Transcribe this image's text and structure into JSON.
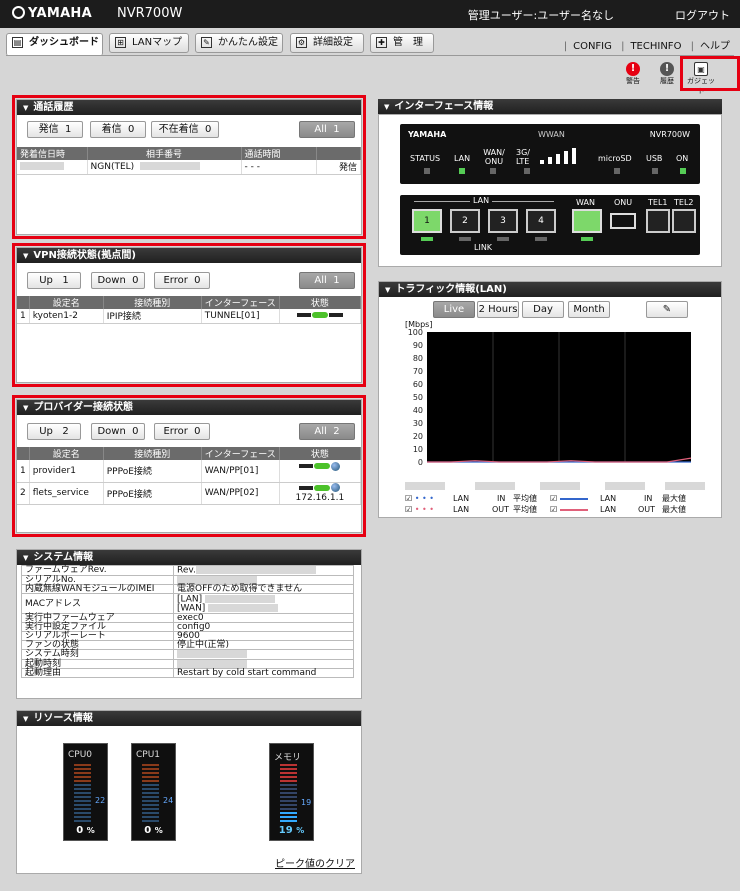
{
  "header": {
    "logo": "YAMAHA",
    "model": "NVR700W",
    "admin_user": "管理ユーザー:ユーザー名なし",
    "logout": "ログアウト"
  },
  "tabs": [
    {
      "label": "ダッシュボード",
      "active": true
    },
    {
      "label": "LANマップ"
    },
    {
      "label": "かんたん設定"
    },
    {
      "label": "詳細設定"
    },
    {
      "label": "管　理"
    }
  ],
  "sublinks": [
    "CONFIG",
    "TECHINFO",
    "ヘルプ"
  ],
  "status_icons": [
    {
      "label": "警告",
      "color": "#e60012"
    },
    {
      "label": "履歴",
      "color": "#555555"
    },
    {
      "label": "ガジェット",
      "color": "#555555"
    }
  ],
  "call_history": {
    "title": "通話履歴",
    "outgoing": "発信",
    "outgoing_count": "1",
    "incoming": "着信",
    "incoming_count": "0",
    "missed": "不在着信",
    "missed_count": "0",
    "all": "All",
    "all_count": "1",
    "columns": [
      "発着信日時",
      "相手番号",
      "通話時間",
      ""
    ],
    "rows": [
      {
        "line": "NGN(TEL)",
        "duration": "- - -",
        "type": "発信"
      }
    ]
  },
  "vpn": {
    "title": "VPN接続状態(拠点間)",
    "up": "Up",
    "up_count": "1",
    "down": "Down",
    "down_count": "0",
    "error": "Error",
    "error_count": "0",
    "all": "All",
    "all_count": "1",
    "columns": [
      "設定名",
      "接続種別",
      "インターフェース",
      "状態"
    ],
    "rows": [
      {
        "no": "1",
        "name": "kyoten1-2",
        "type": "IPIP接続",
        "iface": "TUNNEL[01]"
      }
    ]
  },
  "provider": {
    "title": "プロバイダー接続状態",
    "up": "Up",
    "up_count": "2",
    "down": "Down",
    "down_count": "0",
    "error": "Error",
    "error_count": "0",
    "all": "All",
    "all_count": "2",
    "columns": [
      "設定名",
      "接続種別",
      "インターフェース",
      "状態"
    ],
    "rows": [
      {
        "no": "1",
        "name": "provider1",
        "type": "PPPoE接続",
        "iface": "WAN/PP[01]",
        "ip": ""
      },
      {
        "no": "2",
        "name": "flets_service",
        "type": "PPPoE接続",
        "iface": "WAN/PP[02]",
        "ip": "172.16.1.1"
      }
    ]
  },
  "sysinfo": {
    "title": "システム情報",
    "rows": [
      {
        "k": "ファームウェアRev.",
        "v": "Rev.",
        "blur": true
      },
      {
        "k": "シリアルNo.",
        "v": "",
        "blur": true
      },
      {
        "k": "内蔵無線WANモジュールのIMEI",
        "v": "電源OFFのため取得できません"
      },
      {
        "k": "MACアドレス",
        "v": "[LAN]",
        "v2": "[WAN]",
        "blur": true
      },
      {
        "k": "実行中ファームウェア",
        "v": "exec0"
      },
      {
        "k": "実行中設定ファイル",
        "v": "config0"
      },
      {
        "k": "シリアルボーレート",
        "v": "9600"
      },
      {
        "k": "ファンの状態",
        "v": "停止中(正常)"
      },
      {
        "k": "システム時刻",
        "v": "",
        "blur": true
      },
      {
        "k": "起動時刻",
        "v": "",
        "blur": true
      },
      {
        "k": "起動理由",
        "v": "Restart by cold start command"
      }
    ]
  },
  "resource": {
    "title": "リソース情報",
    "cpu0": {
      "label": "CPU0",
      "value": "0",
      "peak": "22"
    },
    "cpu1": {
      "label": "CPU1",
      "value": "0",
      "peak": "24"
    },
    "mem": {
      "label": "メモリ",
      "value": "19",
      "peak": "19"
    },
    "percent": "%",
    "clear_peak": "ピーク値のクリア"
  },
  "iface": {
    "title": "インターフェース情報",
    "brand": "YAMAHA",
    "model": "NVR700W",
    "wwan": "WWAN",
    "leds": [
      "STATUS",
      "LAN",
      "WAN/ ONU",
      "3G/ LTE",
      "microSD",
      "USB",
      "ON"
    ],
    "lan": "LAN",
    "link": "LINK",
    "wan": "WAN",
    "onu": "ONU",
    "tel1": "TEL1",
    "tel2": "TEL2",
    "ports": [
      "1",
      "2",
      "3",
      "4"
    ]
  },
  "traffic": {
    "title": "トラフィック情報(LAN)",
    "buttons": [
      "Live",
      "2 Hours",
      "Day",
      "Month"
    ],
    "unit": "[Mbps]",
    "y_ticks": [
      "100",
      "90",
      "80",
      "70",
      "60",
      "50",
      "40",
      "30",
      "20",
      "10",
      "0"
    ],
    "legend": [
      {
        "if": "LAN",
        "dir": "IN",
        "stat": "平均値",
        "style": "dotted",
        "color": "#3366cc"
      },
      {
        "if": "LAN",
        "dir": "OUT",
        "stat": "平均値",
        "style": "dotted",
        "color": "#e0607a"
      },
      {
        "if": "LAN",
        "dir": "IN",
        "stat": "最大値",
        "style": "solid",
        "color": "#3366cc"
      },
      {
        "if": "LAN",
        "dir": "OUT",
        "stat": "最大値",
        "style": "solid",
        "color": "#e0607a"
      }
    ]
  },
  "chart_data": {
    "type": "line",
    "ylabel": "[Mbps]",
    "ylim": [
      0,
      100
    ],
    "series": [
      {
        "name": "LAN IN 最大値",
        "values": [
          0,
          0,
          0,
          0,
          0,
          0,
          0,
          0,
          0,
          0,
          0,
          0
        ]
      },
      {
        "name": "LAN OUT 最大値",
        "values": [
          0,
          0,
          1,
          0,
          0,
          0,
          1,
          0,
          0,
          0,
          0,
          3
        ]
      }
    ]
  }
}
